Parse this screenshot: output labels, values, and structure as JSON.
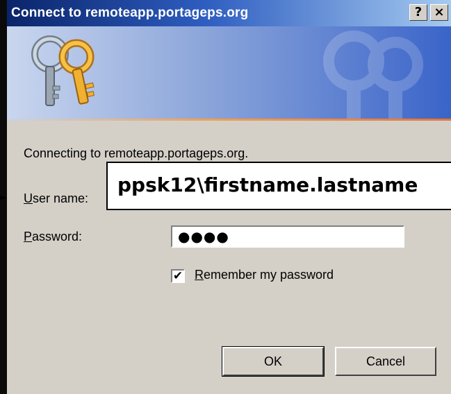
{
  "titlebar": {
    "title": "Connect to remoteapp.portageps.org",
    "help_label": "?",
    "close_label": "×"
  },
  "banner": {
    "icon": "keys-icon"
  },
  "form": {
    "connecting_text": "Connecting to remoteapp.portageps.org.",
    "user_label_key": "U",
    "user_label_rest": "ser name:",
    "user_value": "",
    "password_label_key": "P",
    "password_label_rest": "assword:",
    "password_value": "●●●●",
    "remember_checked": true,
    "remember_check_glyph": "✔",
    "remember_key": "R",
    "remember_rest": "emember my password"
  },
  "buttons": {
    "ok_label": "OK",
    "cancel_label": "Cancel"
  },
  "callout": {
    "text": "ppsk12\\firstname.lastname"
  },
  "colors": {
    "title_gradient_start": "#0a246a",
    "title_gradient_end": "#a6caf0",
    "dialog_face": "#d4d0c8",
    "banner_accent": "#e8743a"
  }
}
